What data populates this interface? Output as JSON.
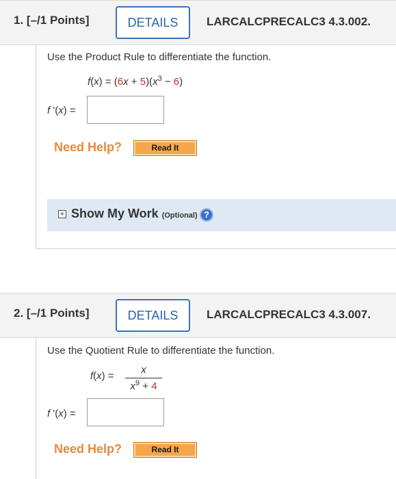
{
  "questions": [
    {
      "number": "1.",
      "points": "[–/1 Points]",
      "details_label": "DETAILS",
      "code": "LARCALCPRECALC3 4.3.002.",
      "prompt": "Use the Product Rule to differentiate the function.",
      "function_lhs": "f(x) = (",
      "function_parts": {
        "c1": "6",
        "x1": "x",
        "plus": " + ",
        "c2": "5",
        "mid": ")(",
        "x2": "x",
        "exp": "3",
        "minus": " − ",
        "c3": "6",
        "close": ")"
      },
      "answer_label": "f '(x) =",
      "answer_value": "",
      "need_help": "Need Help?",
      "read_it": "Read It",
      "show_work": "Show My Work",
      "optional": "(Optional)"
    },
    {
      "number": "2.",
      "points": "[–/1 Points]",
      "details_label": "DETAILS",
      "code": "LARCALCPRECALC3 4.3.007.",
      "prompt": "Use the Quotient Rule to differentiate the function.",
      "function_lhs": "f(x) =",
      "numerator": "x",
      "denominator": {
        "x": "x",
        "exp": "9",
        "plus": " + ",
        "c": "4"
      },
      "answer_label": "f '(x) =",
      "answer_value": "",
      "need_help": "Need Help?",
      "read_it": "Read It"
    }
  ],
  "colors": {
    "accent_blue": "#3a72b8",
    "need_help_orange": "#e8893a",
    "read_it_button": "#f5a64a",
    "red_constant": "#c62828",
    "show_work_bg": "#dfe9f3"
  },
  "icons": {
    "expand": "plus-square-icon",
    "help": "question-circle-icon"
  }
}
